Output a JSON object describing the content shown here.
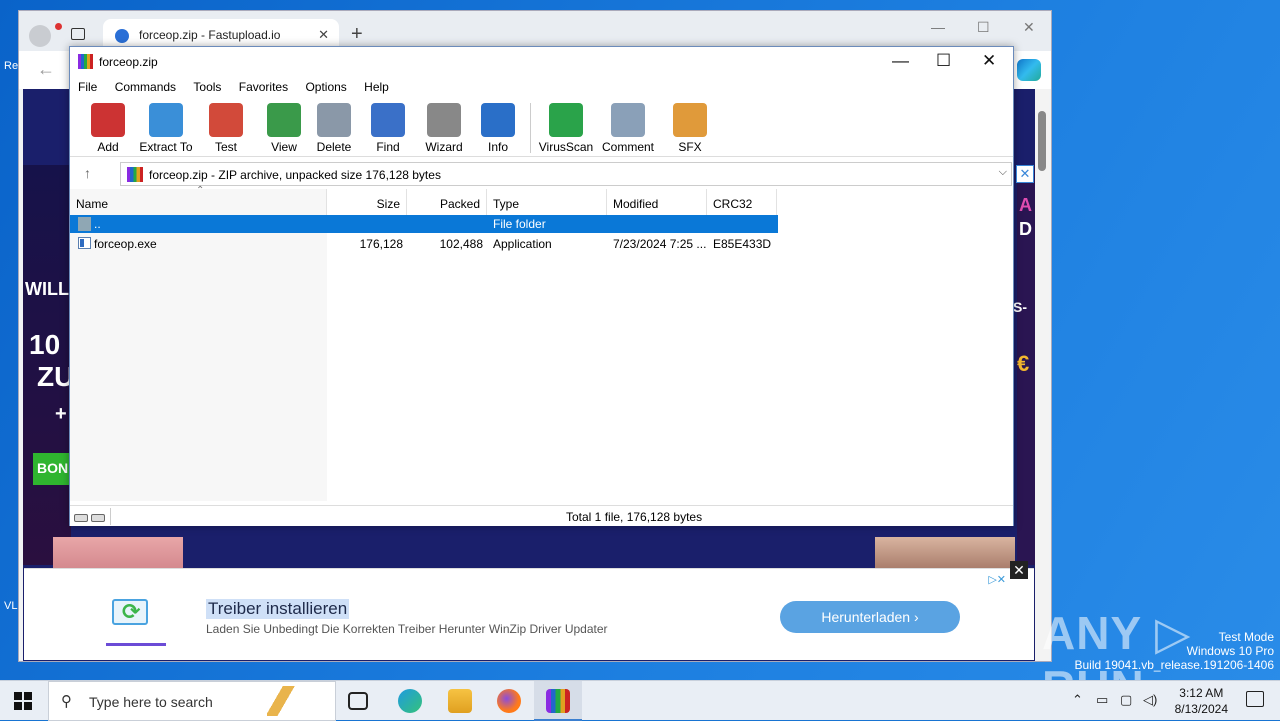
{
  "browser": {
    "tab_title": "forceop.zip - Fastupload.io",
    "tab_close": "✕",
    "new_tab": "+",
    "minimize": "—",
    "maximize": "☐",
    "close": "✕",
    "back": "←"
  },
  "page": {
    "left_texts": [
      "WILL",
      "10",
      "ZU",
      "+",
      "BON"
    ],
    "right_texts": [
      "A",
      "D",
      "S-",
      "€"
    ]
  },
  "ad": {
    "title": "Treiber installieren",
    "subtitle": "Laden Sie Unbedingt Die Korrekten Treiber Herunter WinZip Driver Updater",
    "button": "Herunterladen ›",
    "close": "✕",
    "badge": "▷✕"
  },
  "winrar": {
    "title": "forceop.zip",
    "controls": {
      "minimize": "—",
      "maximize": "☐",
      "close": "✕"
    },
    "menu": [
      "File",
      "Commands",
      "Tools",
      "Favorites",
      "Options",
      "Help"
    ],
    "toolbar": [
      {
        "label": "Add",
        "icon": "add-archive-icon",
        "color": "#c33"
      },
      {
        "label": "Extract To",
        "icon": "extract-folder-icon",
        "color": "#3a8fd8"
      },
      {
        "label": "Test",
        "icon": "test-clipboard-icon",
        "color": "#d24a3a"
      },
      {
        "label": "View",
        "icon": "view-book-icon",
        "color": "#3a9a4a"
      },
      {
        "label": "Delete",
        "icon": "delete-trash-icon",
        "color": "#8a98a8"
      },
      {
        "label": "Find",
        "icon": "find-magnifier-icon",
        "color": "#3a70c8"
      },
      {
        "label": "Wizard",
        "icon": "wizard-wand-icon",
        "color": "#888"
      },
      {
        "label": "Info",
        "icon": "info-icon",
        "color": "#2a6fc8"
      },
      {
        "label": "VirusScan",
        "icon": "virusscan-bug-icon",
        "color": "#2aa34a"
      },
      {
        "label": "Comment",
        "icon": "comment-icon",
        "color": "#8aa0b8"
      },
      {
        "label": "SFX",
        "icon": "sfx-box-icon",
        "color": "#e09a3a"
      }
    ],
    "address": {
      "up": "↑",
      "text": "forceop.zip - ZIP archive, unpacked size 176,128 bytes",
      "dropdown": "⌵",
      "close": "✕"
    },
    "columns": [
      "Name",
      "Size",
      "Packed",
      "Type",
      "Modified",
      "CRC32"
    ],
    "sort_indicator": "⌃",
    "rows": [
      {
        "name": "..",
        "size": "",
        "packed": "",
        "type": "File folder",
        "modified": "",
        "crc": "",
        "selected": true
      },
      {
        "name": "forceop.exe",
        "size": "176,128",
        "packed": "102,488",
        "type": "Application",
        "modified": "7/23/2024 7:25 ...",
        "crc": "E85E433D",
        "selected": false
      }
    ],
    "status_text": "Total 1 file, 176,128 bytes"
  },
  "taskbar": {
    "search_placeholder": "Type here to search",
    "time": "3:12 AM",
    "date": "8/13/2024",
    "tray_arrow": "⌃"
  },
  "overlay": {
    "watermark": "ANY ▷ RUN",
    "test_mode": "Test Mode",
    "os": "Windows 10 Pro",
    "build": "Build 19041.vb_release.191206-1406"
  },
  "colors": {
    "selection": "#0a78d7",
    "desktop": "#1874d2",
    "ad_button": "#5aa3e2"
  }
}
